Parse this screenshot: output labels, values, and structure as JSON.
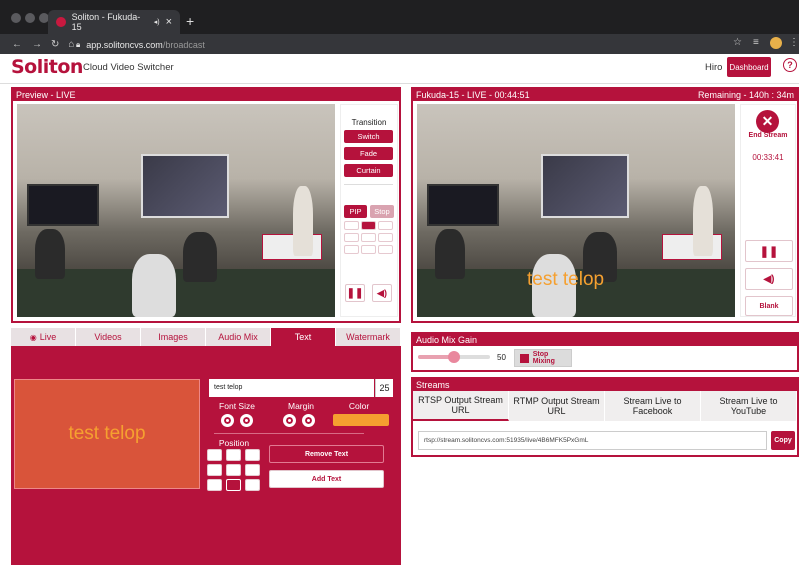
{
  "browser": {
    "tab_title": "Soliton - Fukuda-15",
    "tab_audio": "◂)",
    "tab_close": "×",
    "new_tab": "+",
    "url_domain": "app.solitoncvs.com",
    "url_path": "/broadcast"
  },
  "app": {
    "logo": "Soliton",
    "title": "Cloud Video Switcher",
    "user": "Hiro",
    "dashboard_label": "Dashboard",
    "help_label": "?"
  },
  "preview": {
    "header": "Preview - LIVE",
    "transition_label": "Transition",
    "switch_label": "Switch",
    "fade_label": "Fade",
    "curtain_label": "Curtain",
    "pip_label": "PIP",
    "stop_label": "Stop"
  },
  "live": {
    "header": "Fukuda-15 - LIVE  -  00:44:51",
    "remaining": "Remaining - 140h : 34m",
    "end_stream_label": "End Stream",
    "timer": "00:33:41",
    "blank_label": "Blank",
    "telop_overlay": "test telop"
  },
  "tabs": [
    {
      "label": "Live",
      "icon": "eye-icon"
    },
    {
      "label": "Videos"
    },
    {
      "label": "Images"
    },
    {
      "label": "Audio Mix"
    },
    {
      "label": "Text"
    },
    {
      "label": "Watermark"
    }
  ],
  "text_panel": {
    "preview_text": "test telop",
    "input_value": "test telop",
    "size_value": "25",
    "font_size_label": "Font Size",
    "margin_label": "Margin",
    "color_label": "Color",
    "position_label": "Position",
    "remove_label": "Remove Text",
    "add_label": "Add Text",
    "color_value": "#f5a030",
    "preview_bg": "#d9543a"
  },
  "audio": {
    "header": "Audio Mix Gain",
    "gain_value": "50",
    "gain_fraction": 0.5,
    "stop_mixing_label": "Stop Mixing"
  },
  "streams": {
    "header": "Streams",
    "columns": [
      "RTSP Output Stream URL",
      "RTMP Output Stream URL",
      "Stream Live to Facebook",
      "Stream Live to YouTube"
    ],
    "url": "rtsp://stream.solitoncvs.com:51935/live/4B6MFK5PxGmL",
    "copy_label": "Copy"
  },
  "colors": {
    "accent": "#b5123c"
  }
}
